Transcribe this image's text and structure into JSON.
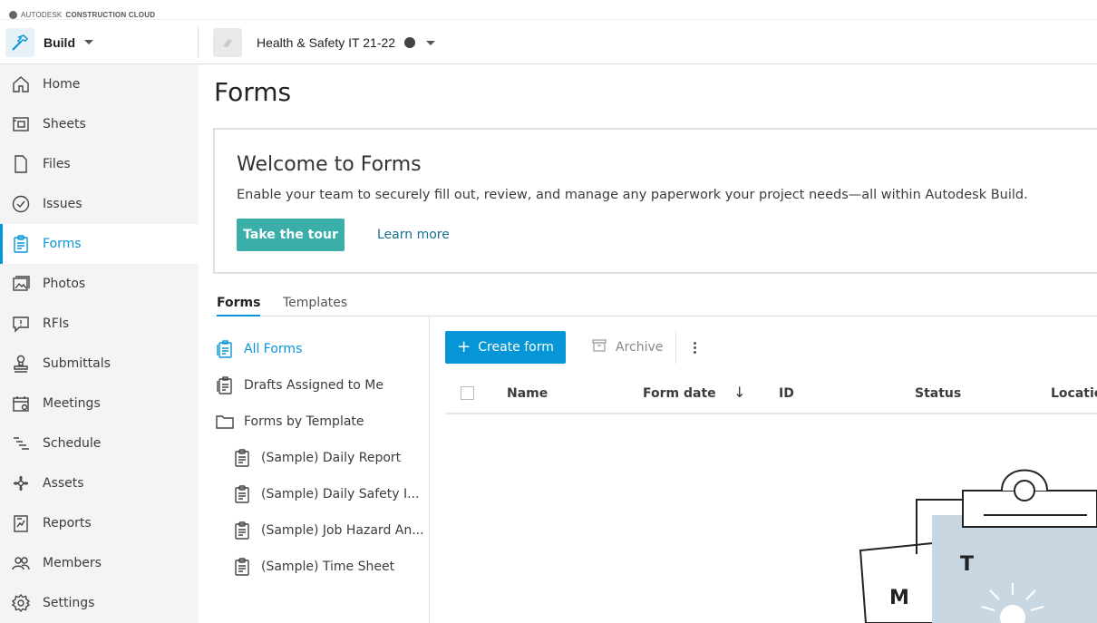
{
  "brand": {
    "prefix": "AUTODESK",
    "product": "CONSTRUCTION CLOUD"
  },
  "header": {
    "app_name": "Build",
    "project_name": "Health & Safety IT 21-22"
  },
  "sidebar": {
    "items": [
      {
        "label": "Home",
        "icon": "home-icon"
      },
      {
        "label": "Sheets",
        "icon": "sheets-icon"
      },
      {
        "label": "Files",
        "icon": "file-icon"
      },
      {
        "label": "Issues",
        "icon": "check-circle-icon"
      },
      {
        "label": "Forms",
        "icon": "clipboard-icon",
        "active": true
      },
      {
        "label": "Photos",
        "icon": "photos-icon"
      },
      {
        "label": "RFIs",
        "icon": "rfi-icon"
      },
      {
        "label": "Submittals",
        "icon": "stamp-icon"
      },
      {
        "label": "Meetings",
        "icon": "calendar-icon"
      },
      {
        "label": "Schedule",
        "icon": "schedule-icon"
      },
      {
        "label": "Assets",
        "icon": "assets-icon"
      },
      {
        "label": "Reports",
        "icon": "reports-icon"
      },
      {
        "label": "Members",
        "icon": "members-icon"
      },
      {
        "label": "Settings",
        "icon": "gear-icon"
      }
    ]
  },
  "main": {
    "title": "Forms",
    "welcome": {
      "heading": "Welcome to Forms",
      "description": "Enable your team to securely fill out, review, and manage any paperwork your project needs—all within Autodesk Build.",
      "tour_button": "Take the tour",
      "learn_more": "Learn more"
    },
    "tabs": [
      {
        "label": "Forms",
        "active": true
      },
      {
        "label": "Templates"
      }
    ],
    "left_list": {
      "all_forms": "All Forms",
      "drafts": "Drafts Assigned to Me",
      "by_template": "Forms by Template",
      "templates": [
        "(Sample) Daily Report",
        "(Sample) Daily Safety I...",
        "(Sample) Job Hazard An...",
        "(Sample) Time Sheet"
      ]
    },
    "toolbar": {
      "create_label": "Create form",
      "archive_label": "Archive"
    },
    "table": {
      "columns": [
        "Name",
        "Form date",
        "ID",
        "Status",
        "Location"
      ]
    },
    "illustration": {
      "letter_back": "M",
      "letter_front": "T"
    }
  },
  "colors": {
    "accent": "#0696d7",
    "tour": "#3aafa9",
    "sidebar_bg": "#f4f4f4"
  }
}
